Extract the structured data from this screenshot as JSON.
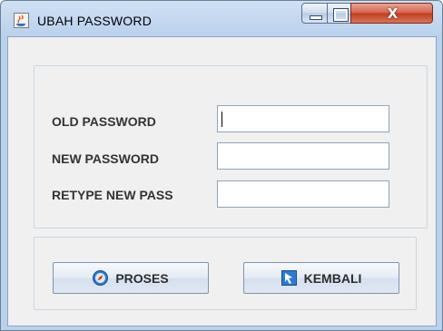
{
  "window": {
    "title": "UBAH PASSWORD",
    "minimize_icon": "minimize-icon",
    "maximize_icon": "maximize-icon",
    "close_icon": "close-icon",
    "close_symbol": "X"
  },
  "form": {
    "fields": [
      {
        "label": "OLD PASSWORD",
        "value": ""
      },
      {
        "label": "NEW PASSWORD",
        "value": ""
      },
      {
        "label": "RETYPE NEW PASS",
        "value": ""
      }
    ]
  },
  "buttons": {
    "proses_label": "PROSES",
    "proses_icon": "compass-icon",
    "kembali_label": "KEMBALI",
    "kembali_icon": "back-arrow-icon"
  },
  "colors": {
    "titlebar": "#b9d1ec",
    "close_button": "#c23b1d",
    "panel_border": "#c9d6e3"
  }
}
